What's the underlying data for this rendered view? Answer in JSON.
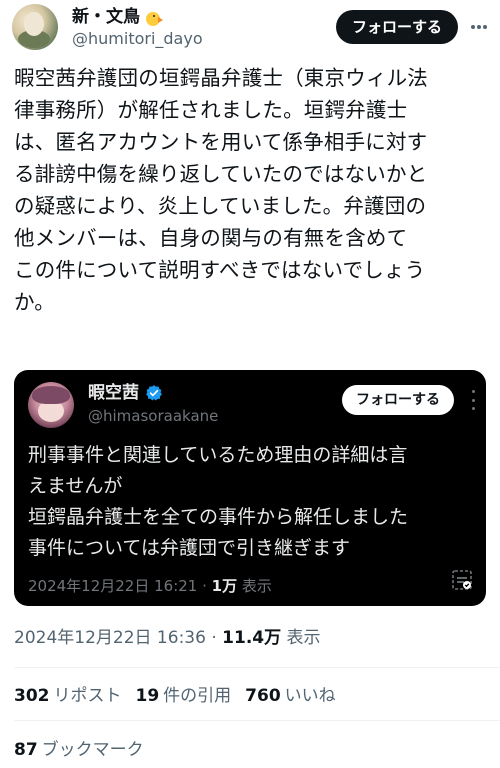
{
  "author": {
    "display_name": "新・文鳥",
    "handle": "@humitori_dayo",
    "emoji_icon": "baby-chick-icon"
  },
  "follow_button_label": "フォローする",
  "tweet_text": "暇空茜弁護団の垣鍔晶弁護士（東京ウィル法\n律事務所）が解任されました。垣鍔弁護士\nは、匿名アカウントを用いて係争相手に対す\nる誹謗中傷を繰り返していたのではないかと\nの疑惑により、炎上していました。弁護団の\n他メンバーは、自身の関与の有無を含めて\nこの件について説明すべきではないでしょう\nか。",
  "quoted": {
    "display_name": "暇空茜",
    "handle": "@himasoraakane",
    "follow_button_label": "フォローする",
    "text": "刑事事件と関連しているため理由の詳細は言\nえませんが\n垣鍔晶弁護士を全ての事件から解任しました\n事件については弁護団で引き継ぎます",
    "timestamp": "2024年12月22日 16:21",
    "views_count": "1万",
    "views_label": "表示",
    "verified_color": "#1d9bf0"
  },
  "meta": {
    "timestamp": "2024年12月22日 16:36",
    "views_count": "11.4万",
    "views_label": "表示"
  },
  "stats": {
    "reposts_count": "302",
    "reposts_label": "リポスト",
    "quotes_count": "19",
    "quotes_label": "件の引用",
    "likes_count": "760",
    "likes_label": "いいね",
    "bookmarks_count": "87",
    "bookmarks_label": "ブックマーク"
  }
}
